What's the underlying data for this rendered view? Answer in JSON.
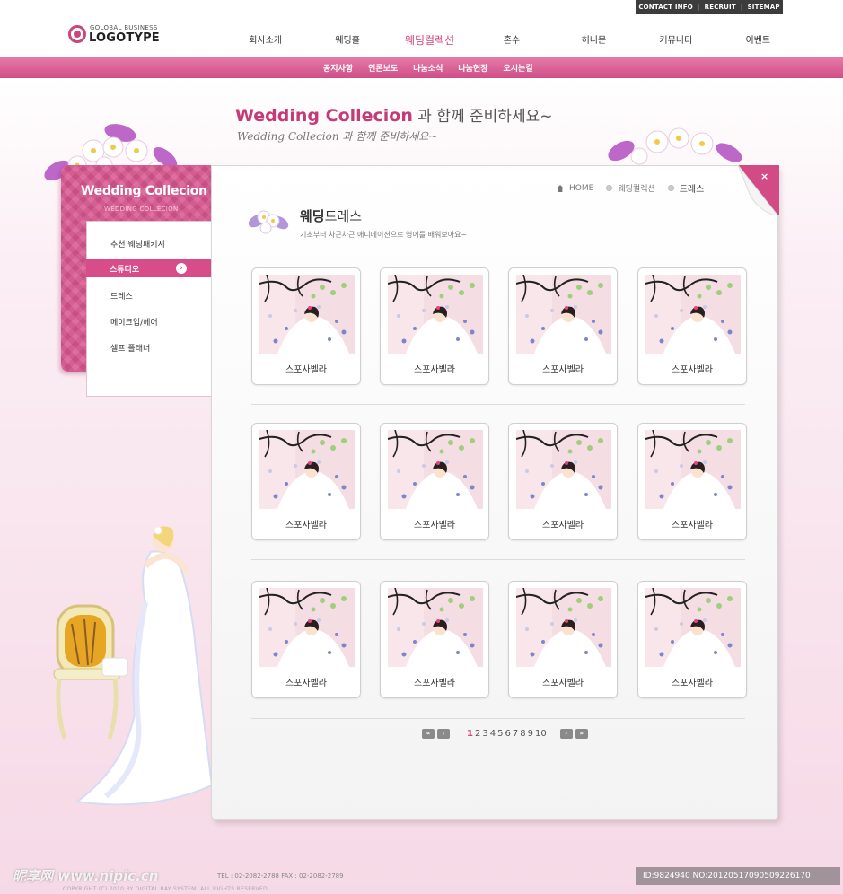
{
  "util_bar": {
    "contact": "CONTACT INFO",
    "sep": "|",
    "recruit": "RECRUIT",
    "sitemap": "SITEMAP"
  },
  "logo": {
    "small": "GOLOBAL BUSINESS",
    "big": "LOGOTYPE"
  },
  "nav": [
    "회사소개",
    "웨딩홀",
    "웨딩컬렉션",
    "혼수",
    "허니문",
    "커뮤니티",
    "이벤트"
  ],
  "nav_active_index": 2,
  "subnav": [
    "공지사항",
    "언론보도",
    "나눔소식",
    "나눔현장",
    "오시는길"
  ],
  "headline": {
    "brand": "Wedding Collecion",
    "rest": " 과 함께 준비하세요~",
    "script": "Wedding Collecion 과 함께 준비하세요~"
  },
  "left_panel": {
    "title": "Wedding Collecion",
    "subtitle": "WEDDING COLLECION",
    "items": [
      "추천 웨딩패키지",
      "스튜디오",
      "드레스",
      "메이크업/헤어",
      "셀프 플래너"
    ],
    "active_index": 1,
    "active_arrow": "›"
  },
  "close": "×",
  "breadcrumb": {
    "home": "HOME",
    "level1": "웨딩컬렉션",
    "current": "드레스"
  },
  "section": {
    "title_bold": "웨딩",
    "title_rest": "드레스",
    "description": "기초부터 차근차근 애니메이션으로 영어를 배워보아요~"
  },
  "gallery": {
    "rows": [
      [
        "스포사벨라",
        "스포사벨라",
        "스포사벨라",
        "스포사벨라"
      ],
      [
        "스포사벨라",
        "스포사벨라",
        "스포사벨라",
        "스포사벨라"
      ],
      [
        "스포사벨라",
        "스포사벨라",
        "스포사벨라",
        "스포사벨라"
      ]
    ]
  },
  "pagination": {
    "first": "«",
    "prev": "‹",
    "next": "›",
    "last": "»",
    "pages": [
      "1",
      "2",
      "3",
      "4",
      "5",
      "6",
      "7",
      "8",
      "9",
      "10"
    ],
    "current": "1"
  },
  "footer": {
    "line1": "TEL : 02-2082-2788    FAX : 02-2082-2789",
    "line2": "COPYRIGHT (C) 2010 BY DIGITAL BAY SYSTEM. ALL RIGHTS RESERVED."
  },
  "watermark": {
    "left": "昵享网 www.nipic.cn",
    "right": "ID:9824940 NO:20120517090509226170"
  },
  "colors": {
    "accent": "#d2417c",
    "subbar": "#cf4f87",
    "panel": "#d8558e"
  }
}
